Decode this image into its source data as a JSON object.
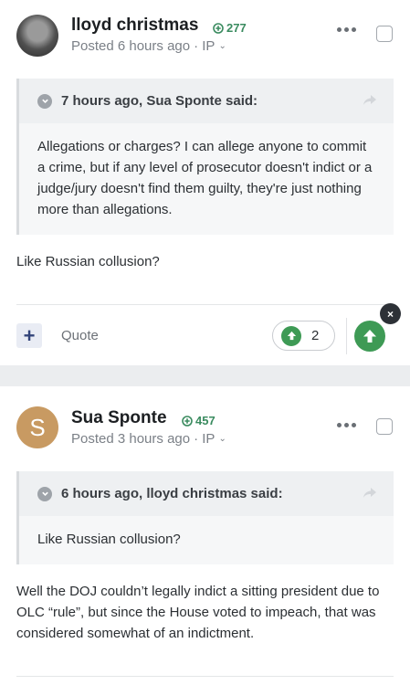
{
  "posts": [
    {
      "author": "lloyd christmas",
      "reputation": "277",
      "posted": "Posted 6 hours ago",
      "ip_label": "· IP",
      "quote": {
        "title": "7 hours ago, Sua Sponte said:",
        "body": "Allegations or charges? I can allege anyone to commit a crime, but if any level of prosecutor doesn't indict or a judge/jury doesn't find them guilty, they're just nothing more than allegations."
      },
      "content": "Like Russian collusion?",
      "actions": {
        "plus": "+",
        "quote": "Quote",
        "reaction_count": "2",
        "close": "×"
      }
    },
    {
      "author": "Sua Sponte",
      "avatar_letter": "S",
      "reputation": "457",
      "posted": "Posted 3 hours ago",
      "ip_label": "· IP",
      "quote": {
        "title": "6 hours ago, lloyd christmas said:",
        "body": "Like Russian collusion?"
      },
      "content": "Well the DOJ couldn’t legally indict a sitting president due to OLC “rule”, but since the House voted to impeach, that was considered somewhat of an indictment."
    }
  ],
  "colors": {
    "reputation_green": "#3a8b5f",
    "upvote_green": "#3e9a55",
    "avatar_s": "#c89a62"
  },
  "icons": [
    "plus-circle-icon",
    "chevron-down-icon",
    "ellipsis-icon",
    "share-icon",
    "upvote-icon",
    "close-icon"
  ]
}
